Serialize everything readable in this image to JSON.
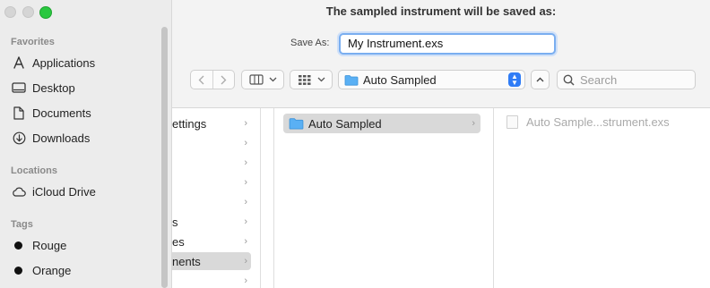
{
  "window": {
    "title": "The sampled instrument will be saved as:"
  },
  "sidebar": {
    "favorites_header": "Favorites",
    "favorites": [
      {
        "label": "Applications",
        "icon": "applications-icon"
      },
      {
        "label": "Desktop",
        "icon": "desktop-icon"
      },
      {
        "label": "Documents",
        "icon": "document-icon"
      },
      {
        "label": "Downloads",
        "icon": "downloads-icon"
      }
    ],
    "locations_header": "Locations",
    "locations": [
      {
        "label": "iCloud Drive",
        "icon": "cloud-icon"
      }
    ],
    "tags_header": "Tags",
    "tags": [
      {
        "label": "Rouge"
      },
      {
        "label": "Orange"
      }
    ]
  },
  "saveas": {
    "label": "Save As:",
    "value": "My Instrument.exs"
  },
  "toolbar": {
    "location": "Auto Sampled",
    "search_placeholder": "Search"
  },
  "columns": {
    "col1": [
      {
        "label": "ettings",
        "selected": false
      },
      {
        "label": "",
        "selected": false
      },
      {
        "label": "",
        "selected": false
      },
      {
        "label": "",
        "selected": false
      },
      {
        "label": "",
        "selected": false
      },
      {
        "label": "s",
        "selected": false
      },
      {
        "label": "es",
        "selected": false
      },
      {
        "label": "nents",
        "selected": true
      },
      {
        "label": "",
        "selected": false
      }
    ],
    "col2": [
      {
        "label": "Auto Sampled",
        "selected": true
      }
    ],
    "col3": [
      {
        "label": "Auto Sample...strument.exs"
      }
    ]
  },
  "colors": {
    "accent": "#2f7cf6",
    "selection": "#d9d9d9",
    "zoom": "#2ac840"
  }
}
